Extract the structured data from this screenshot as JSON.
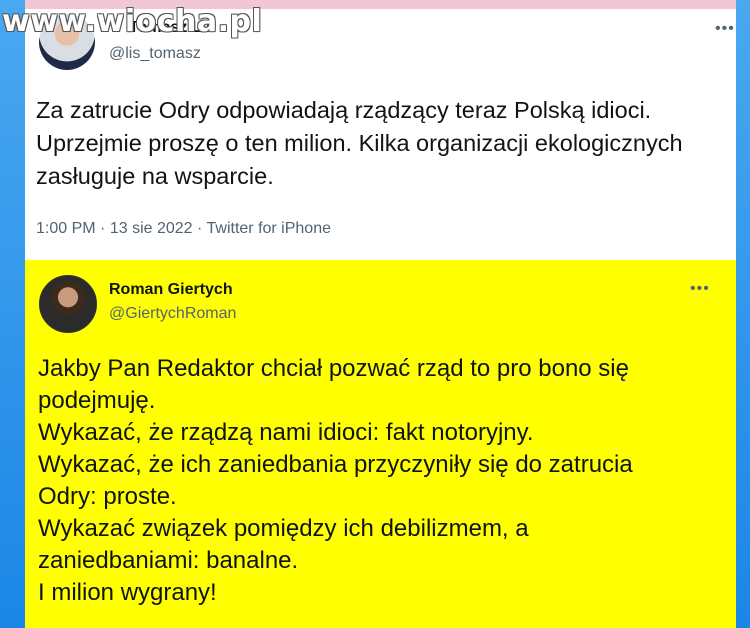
{
  "watermark": "www.wiocha.pl",
  "tweet1": {
    "name": "Tomasz Lis",
    "handle": "@lis_tomasz",
    "text": "Za zatrucie Odry  odpowiadają rządzący teraz Polską idioci. Uprzejmie proszę o ten milion. Kilka organizacji ekologicznych zasługuje na wsparcie.",
    "time": "1:00 PM",
    "date": "13 sie 2022",
    "source": "Twitter for iPhone",
    "more_icon": "more-dots-icon"
  },
  "tweet2": {
    "name": "Roman Giertych",
    "handle": "@GiertychRoman",
    "more_icon": "more-dots-icon",
    "lines": [
      "Jakby Pan Redaktor chciał pozwać rząd to pro bono się",
      "podejmuję.",
      "Wykazać, że rządzą nami idioci: fakt notoryjny.",
      "Wykazać, że ich zaniedbania przyczyniły się do zatrucia",
      "Odry: proste.",
      "Wykazać związek pomiędzy ich debilizmem, a",
      "zaniedbaniami: banalne.",
      "I milion wygrany!"
    ]
  },
  "colors": {
    "frame": "#1da1f2",
    "tweet2_bg": "#ffff00",
    "text": "#0f1419",
    "secondary_text": "#536471"
  }
}
